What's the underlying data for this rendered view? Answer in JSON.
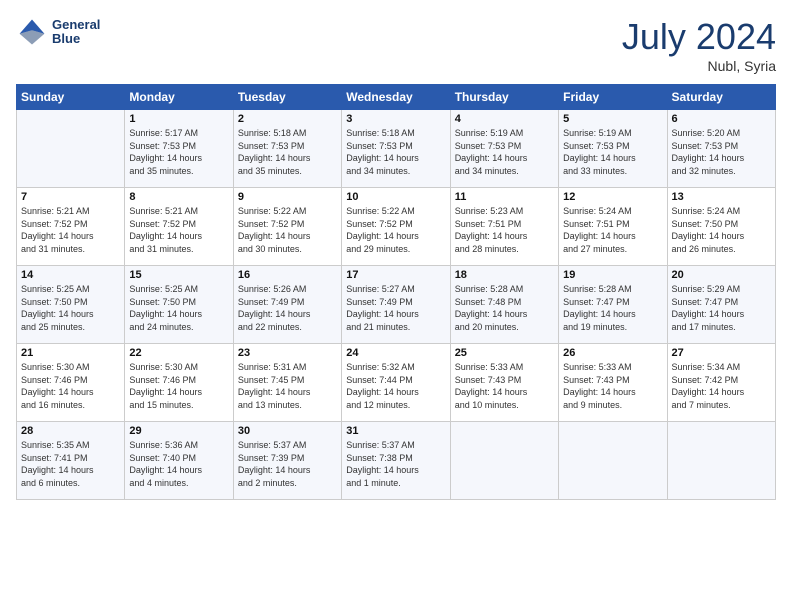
{
  "header": {
    "logo_line1": "General",
    "logo_line2": "Blue",
    "month_year": "July 2024",
    "location": "Nubl, Syria"
  },
  "weekdays": [
    "Sunday",
    "Monday",
    "Tuesday",
    "Wednesday",
    "Thursday",
    "Friday",
    "Saturday"
  ],
  "weeks": [
    [
      {
        "day": "",
        "info": ""
      },
      {
        "day": "1",
        "info": "Sunrise: 5:17 AM\nSunset: 7:53 PM\nDaylight: 14 hours\nand 35 minutes."
      },
      {
        "day": "2",
        "info": "Sunrise: 5:18 AM\nSunset: 7:53 PM\nDaylight: 14 hours\nand 35 minutes."
      },
      {
        "day": "3",
        "info": "Sunrise: 5:18 AM\nSunset: 7:53 PM\nDaylight: 14 hours\nand 34 minutes."
      },
      {
        "day": "4",
        "info": "Sunrise: 5:19 AM\nSunset: 7:53 PM\nDaylight: 14 hours\nand 34 minutes."
      },
      {
        "day": "5",
        "info": "Sunrise: 5:19 AM\nSunset: 7:53 PM\nDaylight: 14 hours\nand 33 minutes."
      },
      {
        "day": "6",
        "info": "Sunrise: 5:20 AM\nSunset: 7:53 PM\nDaylight: 14 hours\nand 32 minutes."
      }
    ],
    [
      {
        "day": "7",
        "info": "Sunrise: 5:21 AM\nSunset: 7:52 PM\nDaylight: 14 hours\nand 31 minutes."
      },
      {
        "day": "8",
        "info": "Sunrise: 5:21 AM\nSunset: 7:52 PM\nDaylight: 14 hours\nand 31 minutes."
      },
      {
        "day": "9",
        "info": "Sunrise: 5:22 AM\nSunset: 7:52 PM\nDaylight: 14 hours\nand 30 minutes."
      },
      {
        "day": "10",
        "info": "Sunrise: 5:22 AM\nSunset: 7:52 PM\nDaylight: 14 hours\nand 29 minutes."
      },
      {
        "day": "11",
        "info": "Sunrise: 5:23 AM\nSunset: 7:51 PM\nDaylight: 14 hours\nand 28 minutes."
      },
      {
        "day": "12",
        "info": "Sunrise: 5:24 AM\nSunset: 7:51 PM\nDaylight: 14 hours\nand 27 minutes."
      },
      {
        "day": "13",
        "info": "Sunrise: 5:24 AM\nSunset: 7:50 PM\nDaylight: 14 hours\nand 26 minutes."
      }
    ],
    [
      {
        "day": "14",
        "info": "Sunrise: 5:25 AM\nSunset: 7:50 PM\nDaylight: 14 hours\nand 25 minutes."
      },
      {
        "day": "15",
        "info": "Sunrise: 5:25 AM\nSunset: 7:50 PM\nDaylight: 14 hours\nand 24 minutes."
      },
      {
        "day": "16",
        "info": "Sunrise: 5:26 AM\nSunset: 7:49 PM\nDaylight: 14 hours\nand 22 minutes."
      },
      {
        "day": "17",
        "info": "Sunrise: 5:27 AM\nSunset: 7:49 PM\nDaylight: 14 hours\nand 21 minutes."
      },
      {
        "day": "18",
        "info": "Sunrise: 5:28 AM\nSunset: 7:48 PM\nDaylight: 14 hours\nand 20 minutes."
      },
      {
        "day": "19",
        "info": "Sunrise: 5:28 AM\nSunset: 7:47 PM\nDaylight: 14 hours\nand 19 minutes."
      },
      {
        "day": "20",
        "info": "Sunrise: 5:29 AM\nSunset: 7:47 PM\nDaylight: 14 hours\nand 17 minutes."
      }
    ],
    [
      {
        "day": "21",
        "info": "Sunrise: 5:30 AM\nSunset: 7:46 PM\nDaylight: 14 hours\nand 16 minutes."
      },
      {
        "day": "22",
        "info": "Sunrise: 5:30 AM\nSunset: 7:46 PM\nDaylight: 14 hours\nand 15 minutes."
      },
      {
        "day": "23",
        "info": "Sunrise: 5:31 AM\nSunset: 7:45 PM\nDaylight: 14 hours\nand 13 minutes."
      },
      {
        "day": "24",
        "info": "Sunrise: 5:32 AM\nSunset: 7:44 PM\nDaylight: 14 hours\nand 12 minutes."
      },
      {
        "day": "25",
        "info": "Sunrise: 5:33 AM\nSunset: 7:43 PM\nDaylight: 14 hours\nand 10 minutes."
      },
      {
        "day": "26",
        "info": "Sunrise: 5:33 AM\nSunset: 7:43 PM\nDaylight: 14 hours\nand 9 minutes."
      },
      {
        "day": "27",
        "info": "Sunrise: 5:34 AM\nSunset: 7:42 PM\nDaylight: 14 hours\nand 7 minutes."
      }
    ],
    [
      {
        "day": "28",
        "info": "Sunrise: 5:35 AM\nSunset: 7:41 PM\nDaylight: 14 hours\nand 6 minutes."
      },
      {
        "day": "29",
        "info": "Sunrise: 5:36 AM\nSunset: 7:40 PM\nDaylight: 14 hours\nand 4 minutes."
      },
      {
        "day": "30",
        "info": "Sunrise: 5:37 AM\nSunset: 7:39 PM\nDaylight: 14 hours\nand 2 minutes."
      },
      {
        "day": "31",
        "info": "Sunrise: 5:37 AM\nSunset: 7:38 PM\nDaylight: 14 hours\nand 1 minute."
      },
      {
        "day": "",
        "info": ""
      },
      {
        "day": "",
        "info": ""
      },
      {
        "day": "",
        "info": ""
      }
    ]
  ]
}
